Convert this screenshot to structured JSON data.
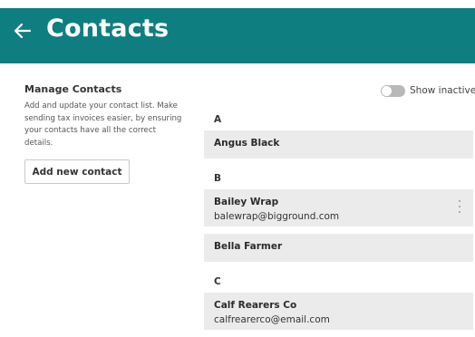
{
  "colors": {
    "header_bg": "#0f7e80",
    "row_bg": "#ebebeb",
    "toggle_off": "#b8b8b8"
  },
  "header": {
    "title": "Contacts",
    "back_icon": "arrow-left-icon"
  },
  "sidebar": {
    "title": "Manage Contacts",
    "description": "Add and update your contact list. Make sending tax invoices easier, by ensuring your contacts have all the correct details.",
    "add_button_label": "Add new contact"
  },
  "filter": {
    "toggle_label": "Show inactive",
    "toggle_on": false
  },
  "groups": [
    {
      "letter": "A",
      "contacts": [
        {
          "name": "Angus Black",
          "email": ""
        }
      ]
    },
    {
      "letter": "B",
      "contacts": [
        {
          "name": "Bailey Wrap",
          "email": "balewrap@bigground.com",
          "menu_icon": "more-vertical-icon"
        },
        {
          "name": "Bella Farmer",
          "email": ""
        }
      ]
    },
    {
      "letter": "C",
      "contacts": [
        {
          "name": "Calf Rearers Co",
          "email": "calfrearerco@email.com"
        }
      ]
    }
  ]
}
